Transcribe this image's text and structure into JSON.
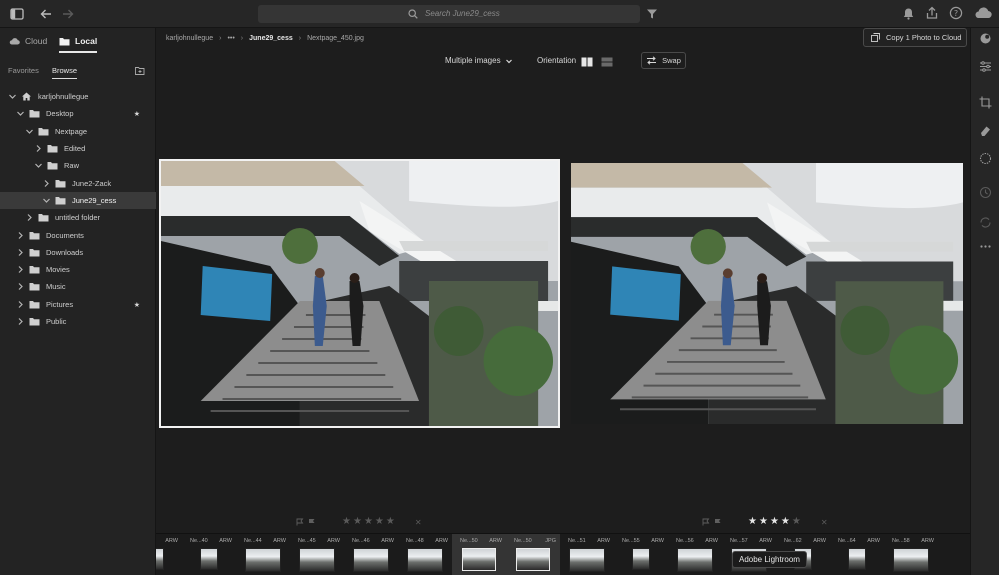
{
  "topbar": {
    "search_placeholder": "Search June29_cess",
    "colors": {
      "accent": "#1473e6"
    }
  },
  "sources": {
    "cloud_label": "Cloud",
    "local_label": "Local",
    "active": "Local"
  },
  "subtabs": {
    "favorites_label": "Favorites",
    "browse_label": "Browse",
    "active": "Browse"
  },
  "tree": [
    {
      "label": "karljohnullegue",
      "icon": "home-icon",
      "expanded": true
    },
    {
      "label": "Desktop",
      "icon": "folder-icon",
      "expanded": true,
      "starred": true
    },
    {
      "label": "Nextpage",
      "icon": "folder-icon",
      "expanded": true
    },
    {
      "label": "Edited",
      "icon": "folder-icon",
      "expanded": false
    },
    {
      "label": "Raw",
      "icon": "folder-icon",
      "expanded": true
    },
    {
      "label": "June2-Zack",
      "icon": "folder-icon",
      "expanded": false
    },
    {
      "label": "June29_cess",
      "icon": "folder-icon",
      "expanded": true,
      "selected": true
    },
    {
      "label": "untitled folder",
      "icon": "folder-icon",
      "expanded": false
    },
    {
      "label": "Documents",
      "icon": "folder-icon",
      "expanded": false
    },
    {
      "label": "Downloads",
      "icon": "folder-icon",
      "expanded": false
    },
    {
      "label": "Movies",
      "icon": "folder-icon",
      "expanded": false
    },
    {
      "label": "Music",
      "icon": "folder-icon",
      "expanded": false
    },
    {
      "label": "Pictures",
      "icon": "folder-icon",
      "expanded": false,
      "starred": true
    },
    {
      "label": "Public",
      "icon": "folder-icon",
      "expanded": false
    }
  ],
  "breadcrumb": {
    "root": "karljohnullegue",
    "ellipsis": "•••",
    "current": "June29_cess",
    "file": "Nextpage_450.jpg"
  },
  "copy_button": {
    "label": "Copy 1 Photo to Cloud"
  },
  "compare": {
    "view_mode_label": "Multiple images",
    "orientation_label": "Orientation",
    "swap_label": "Swap"
  },
  "ratings": {
    "left": {
      "stars": 0,
      "max": 5
    },
    "right": {
      "stars": 4,
      "max": 5
    }
  },
  "filmstrip": [
    {
      "name": "Ne...39",
      "ext": "ARW"
    },
    {
      "name": "Ne...40",
      "ext": "ARW"
    },
    {
      "name": "Ne...44",
      "ext": "ARW"
    },
    {
      "name": "Ne...45",
      "ext": "ARW"
    },
    {
      "name": "Ne...46",
      "ext": "ARW"
    },
    {
      "name": "Ne...48",
      "ext": "ARW"
    },
    {
      "name": "Ne...50",
      "ext": "ARW",
      "selected": true
    },
    {
      "name": "Ne...50",
      "ext": "JPG",
      "selected": true
    },
    {
      "name": "Ne...51",
      "ext": "ARW"
    },
    {
      "name": "Ne...55",
      "ext": "ARW"
    },
    {
      "name": "Ne...56",
      "ext": "ARW"
    },
    {
      "name": "Ne...57",
      "ext": "ARW"
    },
    {
      "name": "Ne...62",
      "ext": "ARW"
    },
    {
      "name": "Ne...64",
      "ext": "ARW"
    },
    {
      "name": "Ne...58",
      "ext": "ARW"
    }
  ],
  "tooltip": {
    "label": "Adobe Lightroom"
  },
  "right_panel": [
    "edit-circle-icon",
    "sliders-icon",
    "crop-icon",
    "eraser-icon",
    "masking-icon",
    "history-icon",
    "sync-icon",
    "more-icon"
  ]
}
